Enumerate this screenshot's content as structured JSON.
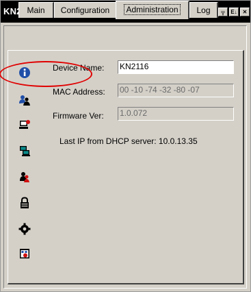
{
  "window": {
    "title": "KN2116 General"
  },
  "title_buttons": [
    {
      "name": "minimize-button",
      "glyph": "▬"
    },
    {
      "name": "tile-button",
      "glyph": "╦"
    },
    {
      "name": "restore-button",
      "glyph": "E↓"
    },
    {
      "name": "close-button",
      "glyph": "✕"
    }
  ],
  "tabs": [
    "Main",
    "Configuration",
    "Administration",
    "Log"
  ],
  "active_tab": "Administration",
  "sidebar_icons": [
    "info-icon",
    "user-admin-icon",
    "computer-security-icon",
    "computer-network-icon",
    "user-management-icon",
    "lock-icon",
    "gear-icon",
    "calendar-icon"
  ],
  "general": {
    "device_name_label": "Device Name:",
    "device_name_value": "KN2116",
    "mac_label": "MAC Address:",
    "mac_value": "00 -10 -74 -32 -80 -07",
    "firmware_label": "Firmware Ver:",
    "firmware_value": "1.0.072",
    "dhcp_text": "Last IP from DHCP server: 10.0.13.35"
  },
  "colors": {
    "annotation": "#e00000",
    "info_icon": "#1f4ea8",
    "title_bar": "#000000",
    "face": "#d4d0c8"
  }
}
